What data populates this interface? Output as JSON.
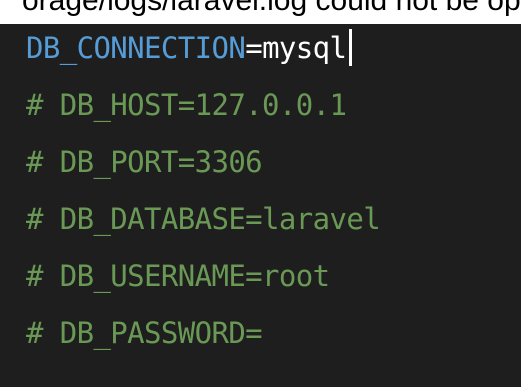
{
  "page_fragment": {
    "top_text": "orage/logs/laravel.log could not be opened: failed to open stream: Permission denied"
  },
  "editor": {
    "active_line": {
      "key": "DB_CONNECTION",
      "operator": "=",
      "value": "mysql"
    },
    "comment_lines": [
      "# DB_HOST=127.0.0.1",
      "# DB_PORT=3306",
      "# DB_DATABASE=laravel",
      "# DB_USERNAME=root",
      "# DB_PASSWORD="
    ]
  },
  "colors": {
    "editor_background": "#1e1e1e",
    "key": "#569cd6",
    "value": "#ffffff",
    "comment": "#6a9955",
    "cursor": "#ffffff"
  }
}
